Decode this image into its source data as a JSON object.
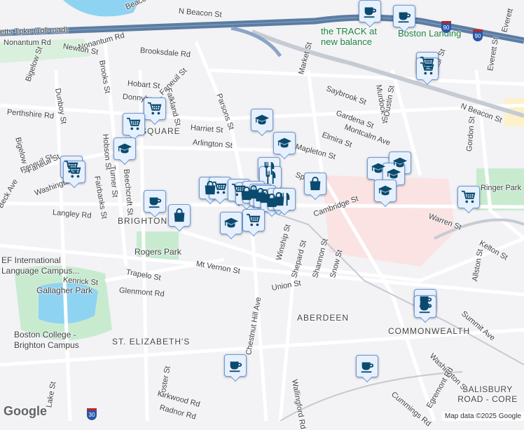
{
  "map": {
    "colors": {
      "marker_bg": "#e7f0fd",
      "marker_border": "#6c9ad6",
      "icon": "#0b4a6f",
      "highway": "#5b7da3",
      "park": "#c8ebd0",
      "water": "#8fd3f2",
      "hospital": "#fbe3e3"
    },
    "road_labels": [
      "Nonantum Rd",
      "Nonantum Rd",
      "Beacon St",
      "N Beacon St",
      "etts Tpke (Toll road)",
      "Newton St",
      "Brooksdale Rd",
      "Hobart St",
      "Donnybrook",
      "Faneuil St",
      "Falkland St",
      "Parsons St",
      "Harriet St",
      "Arlington St",
      "Faneuil St",
      "Market St",
      "Saybrook St",
      "Gardena St",
      "Montcalm Ave",
      "Elmira St",
      "Mapleton St",
      "Murdock St",
      "Dustin St",
      "Spark St",
      "N Beacon St",
      "Everett St",
      "Arthur St",
      "Gordon St",
      "Perthshire Rd",
      "Bigelow St",
      "Dunboy St",
      "Bigelow St",
      "Brooks St",
      "Hobson St",
      "Fairbanks St",
      "Turner St",
      "Beechcroft St",
      "Faneuil St",
      "Washington St",
      "Langley Rd",
      "Beck Ave",
      "Cambridge St",
      "Warren St",
      "Kelton St",
      "Winship St",
      "Shepard St",
      "Shannon St",
      "Snow St",
      "Union St",
      "Mt Vernon St",
      "Trapelo St",
      "Kenrick St",
      "Glenmont Rd",
      "Chestnut Hill Ave",
      "Allston St",
      "Summit Ave",
      "Washington St",
      "Wallingford Rd",
      "Foster St",
      "Kirkwood Rd",
      "Radnor Rd",
      "Lake St",
      "Egremont Rd",
      "Cummings Rd",
      "Everett"
    ],
    "area_labels": [
      "SQUARE",
      "BRIGHTON",
      "ABERDEEN",
      "COMMONWEALTH",
      "ST. ELIZABETH'S",
      "SALISBURY ROAD - CORE"
    ],
    "poi_labels": [
      "the TRACK at new balance",
      "Boston Landing",
      "EF International Language Campus...",
      "Rogers Park",
      "Gallagher Park",
      "Boston College - Brighton Campus",
      "Ringer Park"
    ],
    "highway_shields": [
      "90",
      "90",
      "30"
    ],
    "markers": [
      "coffee",
      "coffee",
      "cart",
      "cart",
      "cart",
      "cart",
      "school",
      "cart",
      "cart",
      "school",
      "school",
      "restaurant",
      "restaurant",
      "shopping",
      "school",
      "school",
      "school",
      "school",
      "cart",
      "coffee",
      "shopping",
      "shopping",
      "cart",
      "cart",
      "shopping",
      "shopping",
      "shopping",
      "shopping",
      "shopping",
      "shopping",
      "restaurant",
      "school",
      "cart",
      "coffee",
      "coffee",
      "coffee",
      "coffee"
    ],
    "logo": "Google",
    "attribution": "Map data ©2025 Google"
  }
}
